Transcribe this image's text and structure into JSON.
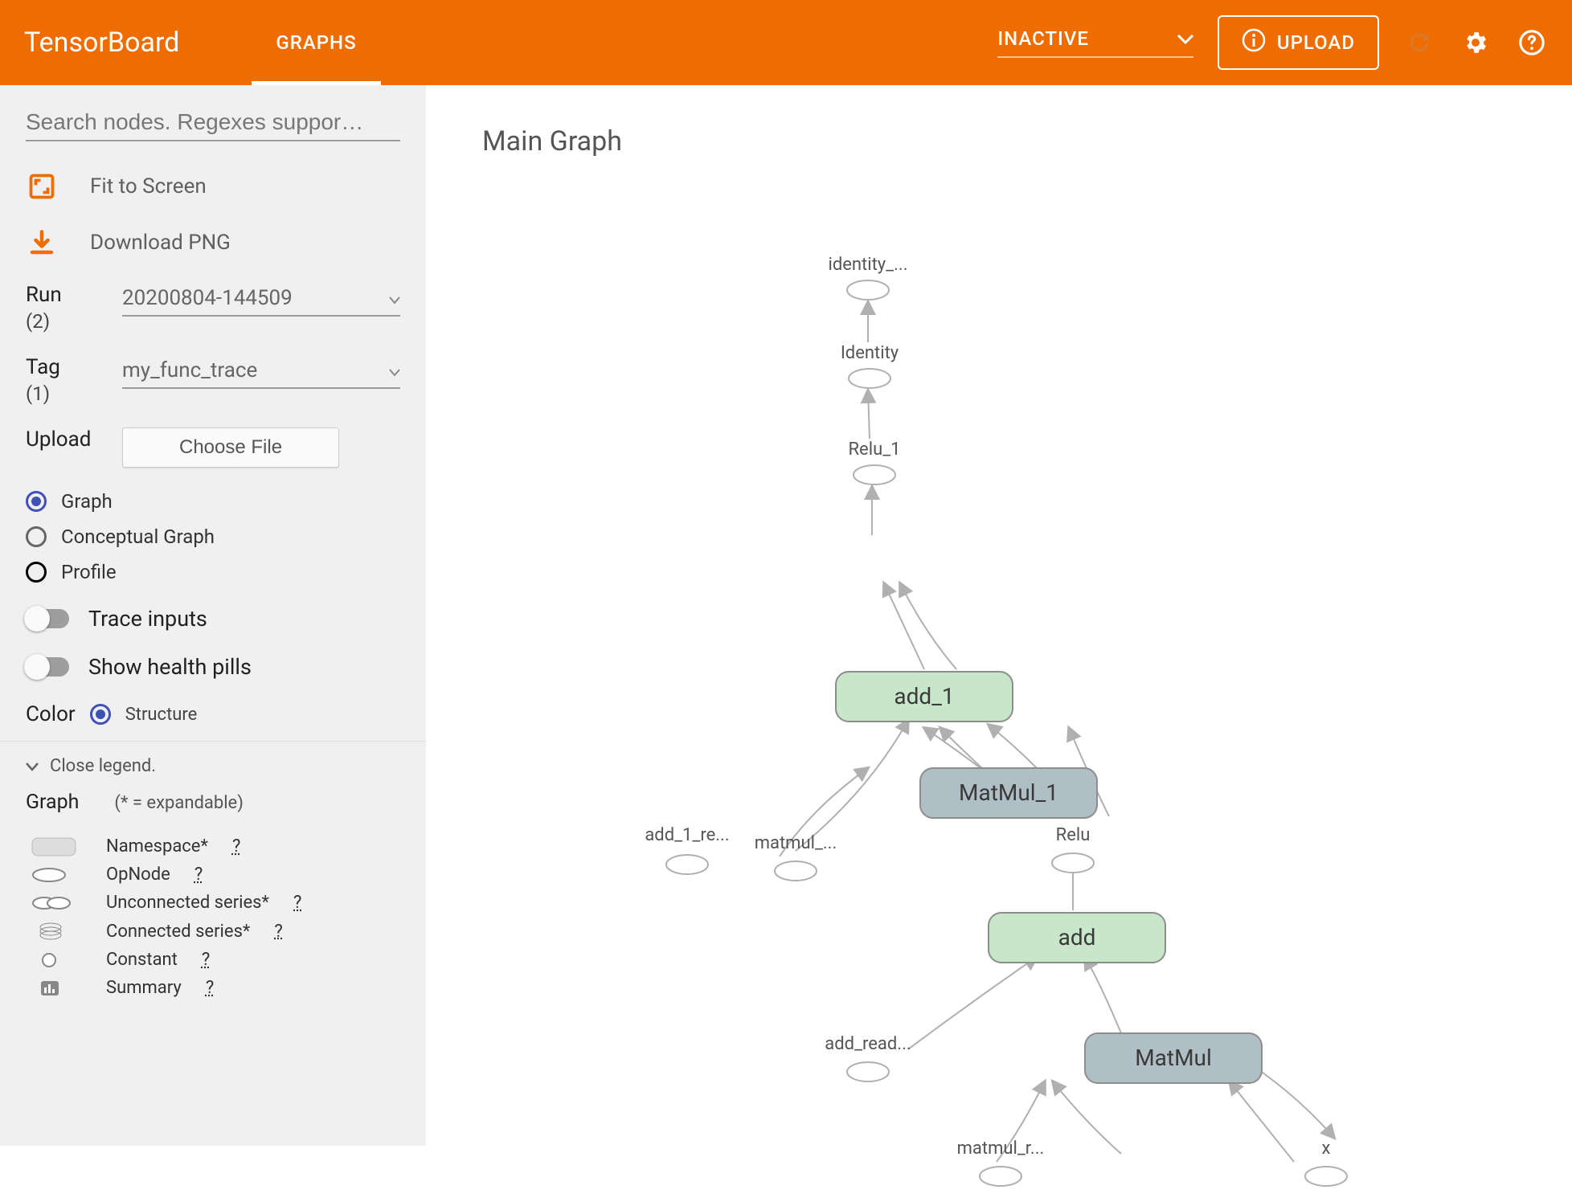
{
  "header": {
    "title": "TensorBoard",
    "active_tab": "GRAPHS",
    "inactive_label": "INACTIVE",
    "upload_label": "UPLOAD"
  },
  "sidebar": {
    "search_placeholder": "Search nodes. Regexes suppor…",
    "fit_label": "Fit to Screen",
    "download_label": "Download PNG",
    "run_label": "Run",
    "run_count": "(2)",
    "run_value": "20200804-144509",
    "tag_label": "Tag",
    "tag_count": "(1)",
    "tag_value": "my_func_trace",
    "upload_label": "Upload",
    "choose_file": "Choose File",
    "radios": {
      "graph": "Graph",
      "conceptual": "Conceptual Graph",
      "profile": "Profile"
    },
    "trace_inputs": "Trace inputs",
    "health_pills": "Show health pills",
    "color_label": "Color",
    "color_value": "Structure",
    "close_legend": "Close legend.",
    "graph_header": "Graph",
    "expandable_note": "(* = expandable)",
    "legend": {
      "namespace": "Namespace*",
      "opnode": "OpNode",
      "unconnected": "Unconnected series*",
      "connected": "Connected series*",
      "constant": "Constant",
      "summary": "Summary"
    }
  },
  "canvas": {
    "title": "Main Graph",
    "nodes": {
      "identity_ret": "identity_...",
      "identity": "Identity",
      "relu1": "Relu_1",
      "add1": "add_1",
      "add1_re": "add_1_re...",
      "matmul1": "MatMul_1",
      "matmul_small": "matmul_...",
      "relu": "Relu",
      "add": "add",
      "add_read": "add_read...",
      "matmul": "MatMul",
      "matmul_r": "matmul_r...",
      "x": "x"
    }
  }
}
